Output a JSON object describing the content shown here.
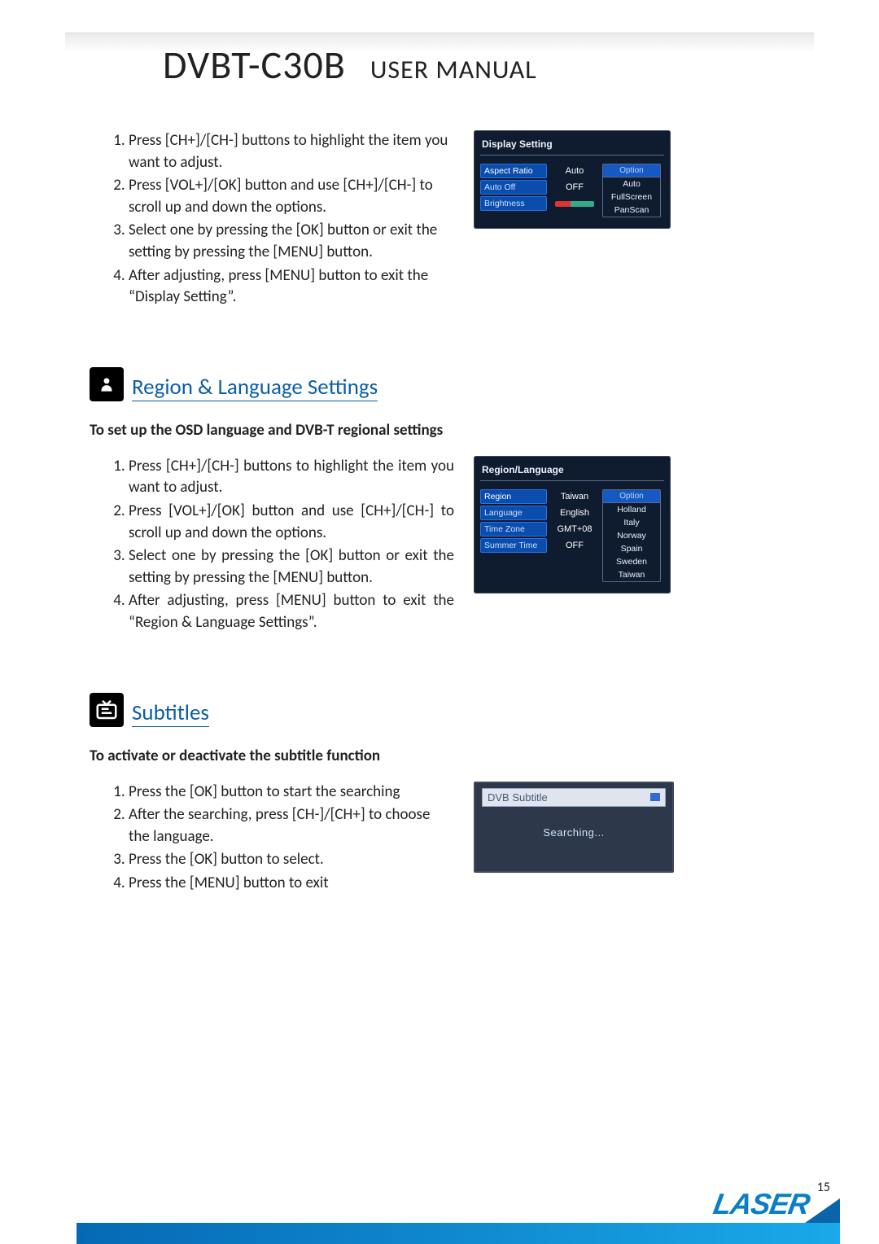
{
  "header": {
    "model": "DVBT-C30B",
    "subtitle": "USER MANUAL"
  },
  "page_number": "15",
  "brand": "LASER",
  "display_setting": {
    "steps": [
      "Press [CH+]/[CH-] buttons to highlight the item you want to adjust.",
      "Press [VOL+]/[OK] button and use [CH+]/[CH-] to scroll up and down the options.",
      "Select one by pressing the [OK] button or exit the setting by pressing the [MENU] button.",
      "After adjusting, press [MENU] button to exit the “Display Setting”."
    ],
    "osd": {
      "title": "Display Setting",
      "rows": [
        {
          "label": "Aspect Ratio",
          "value": "Auto",
          "active": true
        },
        {
          "label": "Auto Off",
          "value": "OFF"
        },
        {
          "label": "Brightness",
          "slider": true
        }
      ],
      "menu_header": "Option",
      "menu_items": [
        "Auto",
        "FullScreen",
        "PanScan"
      ]
    }
  },
  "region_language": {
    "heading": "Region & Language Settings",
    "subhead": "To set up the OSD language and DVB-T regional settings",
    "steps": [
      "Press [CH+]/[CH-] buttons to highlight the item you want to adjust.",
      "Press [VOL+]/[OK] button and use [CH+]/[CH-] to scroll up and down the options.",
      "Select one by pressing the [OK] button or exit the setting by pressing the [MENU] button.",
      "After adjusting, press [MENU] button to exit the “Region & Language Settings”."
    ],
    "osd": {
      "title": "Region/Language",
      "rows": [
        {
          "label": "Region",
          "value": "Taiwan",
          "active": true
        },
        {
          "label": "Language",
          "value": "English"
        },
        {
          "label": "Time Zone",
          "value": "GMT+08"
        },
        {
          "label": "Summer Time",
          "value": "OFF"
        }
      ],
      "menu_header": "Option",
      "menu_items": [
        "Holland",
        "Italy",
        "Norway",
        "Spain",
        "Sweden",
        "Taiwan"
      ]
    }
  },
  "subtitles": {
    "heading": "Subtitles",
    "subhead": "To activate or deactivate the subtitle function",
    "steps": [
      "Press the [OK] button to start the searching",
      " After the searching, press [CH-]/[CH+] to choose the language.",
      "Press the [OK] button to select.",
      "Press the [MENU] button to exit"
    ],
    "osd": {
      "title": "DVB Subtitle",
      "status": "Searching..."
    }
  }
}
